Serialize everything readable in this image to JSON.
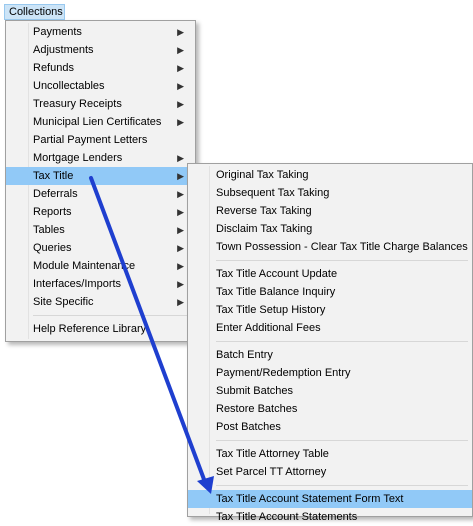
{
  "menubar": {
    "collections": "Collections"
  },
  "main_menu": {
    "items": [
      {
        "label": "Payments",
        "submenu": true
      },
      {
        "label": "Adjustments",
        "submenu": true
      },
      {
        "label": "Refunds",
        "submenu": true
      },
      {
        "label": "Uncollectables",
        "submenu": true
      },
      {
        "label": "Treasury Receipts",
        "submenu": true
      },
      {
        "label": "Municipal Lien Certificates",
        "submenu": true
      },
      {
        "label": "Partial Payment Letters",
        "submenu": false
      },
      {
        "label": "Mortgage Lenders",
        "submenu": true
      },
      {
        "label": "Tax Title",
        "submenu": true
      },
      {
        "label": "Deferrals",
        "submenu": true
      },
      {
        "label": "Reports",
        "submenu": true
      },
      {
        "label": "Tables",
        "submenu": true
      },
      {
        "label": "Queries",
        "submenu": true
      },
      {
        "label": "Module Maintenance",
        "submenu": true
      },
      {
        "label": "Interfaces/Imports",
        "submenu": true
      },
      {
        "label": "Site Specific",
        "submenu": true
      },
      {
        "label": "Help Reference Library",
        "submenu": false
      }
    ]
  },
  "sub_menu": {
    "items": [
      "Original Tax Taking",
      "Subsequent Tax Taking",
      "Reverse Tax Taking",
      "Disclaim Tax Taking",
      "Town Possession - Clear Tax Title Charge Balances",
      "Tax Title Account Update",
      "Tax Title Balance Inquiry",
      "Tax Title Setup History",
      "Enter Additional Fees",
      "Batch Entry",
      "Payment/Redemption Entry",
      "Submit Batches",
      "Restore Batches",
      "Post Batches",
      "Tax Title Attorney Table",
      "Set Parcel TT Attorney",
      "Tax Title Account Statement Form Text",
      "Tax Title Account Statements"
    ]
  },
  "arrow_indicator": {
    "color": "#1f3fcf"
  },
  "colors": {
    "highlight": "#91c9f7",
    "menu_bg": "#f2f2f2"
  }
}
